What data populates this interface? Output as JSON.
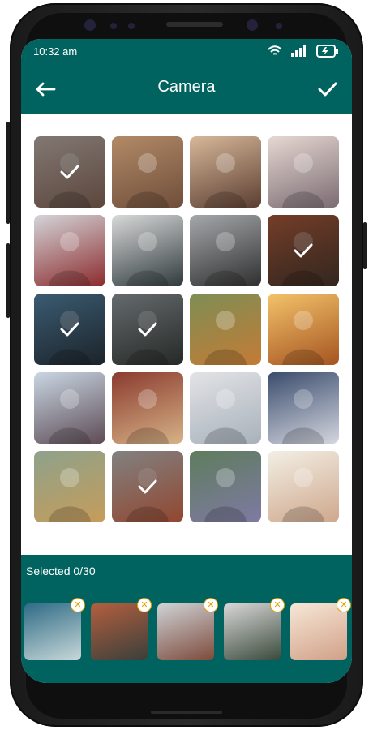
{
  "status_bar": {
    "time": "10:32 am",
    "icons": [
      "wifi-icon",
      "signal-icon",
      "battery-charging-icon"
    ]
  },
  "header": {
    "title": "Camera",
    "back_icon": "back-arrow-icon",
    "done_icon": "check-icon"
  },
  "colors": {
    "primary": "#00635f",
    "white": "#ffffff",
    "close_accent": "#e0a000"
  },
  "gallery": {
    "tiles": [
      {
        "id": 1,
        "selected": true,
        "colors": [
          "#c7b9b1",
          "#8e6d5e"
        ]
      },
      {
        "id": 2,
        "selected": false,
        "colors": [
          "#b28a67",
          "#6f4e3a"
        ]
      },
      {
        "id": 3,
        "selected": false,
        "colors": [
          "#d7b89a",
          "#5b3e31"
        ]
      },
      {
        "id": 4,
        "selected": false,
        "colors": [
          "#e6d8d2",
          "#7b6b73"
        ]
      },
      {
        "id": 5,
        "selected": false,
        "colors": [
          "#d3d5d9",
          "#8c2b2d"
        ]
      },
      {
        "id": 6,
        "selected": false,
        "colors": [
          "#d9d9d9",
          "#2f3a3d"
        ]
      },
      {
        "id": 7,
        "selected": false,
        "colors": [
          "#a5a8ab",
          "#2f2f2f"
        ]
      },
      {
        "id": 8,
        "selected": true,
        "colors": [
          "#b35f3e",
          "#4d3b30"
        ]
      },
      {
        "id": 9,
        "selected": true,
        "colors": [
          "#5b8db0",
          "#2b3640"
        ]
      },
      {
        "id": 10,
        "selected": true,
        "colors": [
          "#9ca4a8",
          "#3a3f3b"
        ]
      },
      {
        "id": 11,
        "selected": false,
        "colors": [
          "#7e8e55",
          "#c37b35"
        ]
      },
      {
        "id": 12,
        "selected": false,
        "colors": [
          "#f3c36a",
          "#a55420"
        ]
      },
      {
        "id": 13,
        "selected": false,
        "colors": [
          "#c9d7e3",
          "#5d4b55"
        ]
      },
      {
        "id": 14,
        "selected": false,
        "colors": [
          "#8b3b2f",
          "#d6b286"
        ]
      },
      {
        "id": 15,
        "selected": false,
        "colors": [
          "#e2e3e6",
          "#a8b1bb"
        ]
      },
      {
        "id": 16,
        "selected": false,
        "colors": [
          "#3a4c6d",
          "#d4d6df"
        ]
      },
      {
        "id": 17,
        "selected": false,
        "colors": [
          "#8ea28b",
          "#c69c5a"
        ]
      },
      {
        "id": 18,
        "selected": true,
        "colors": [
          "#c7c7c7",
          "#e06d4a"
        ]
      },
      {
        "id": 19,
        "selected": false,
        "colors": [
          "#5e7c5d",
          "#7f7aa3"
        ]
      },
      {
        "id": 20,
        "selected": false,
        "colors": [
          "#f2efe5",
          "#cfa78c"
        ]
      }
    ]
  },
  "selected_panel": {
    "label": "Selected 0/30",
    "remove_icon": "close-icon",
    "thumbs": [
      {
        "id": "a",
        "colors": [
          "#2f6b86",
          "#c8d8d9"
        ]
      },
      {
        "id": "b",
        "colors": [
          "#b35f3e",
          "#3a3f3b"
        ]
      },
      {
        "id": "c",
        "colors": [
          "#cfd3d6",
          "#7d4a3b"
        ]
      },
      {
        "id": "d",
        "colors": [
          "#d8d7d6",
          "#3b4a3c"
        ]
      },
      {
        "id": "e",
        "colors": [
          "#f6e7d6",
          "#d1a088"
        ]
      }
    ]
  }
}
